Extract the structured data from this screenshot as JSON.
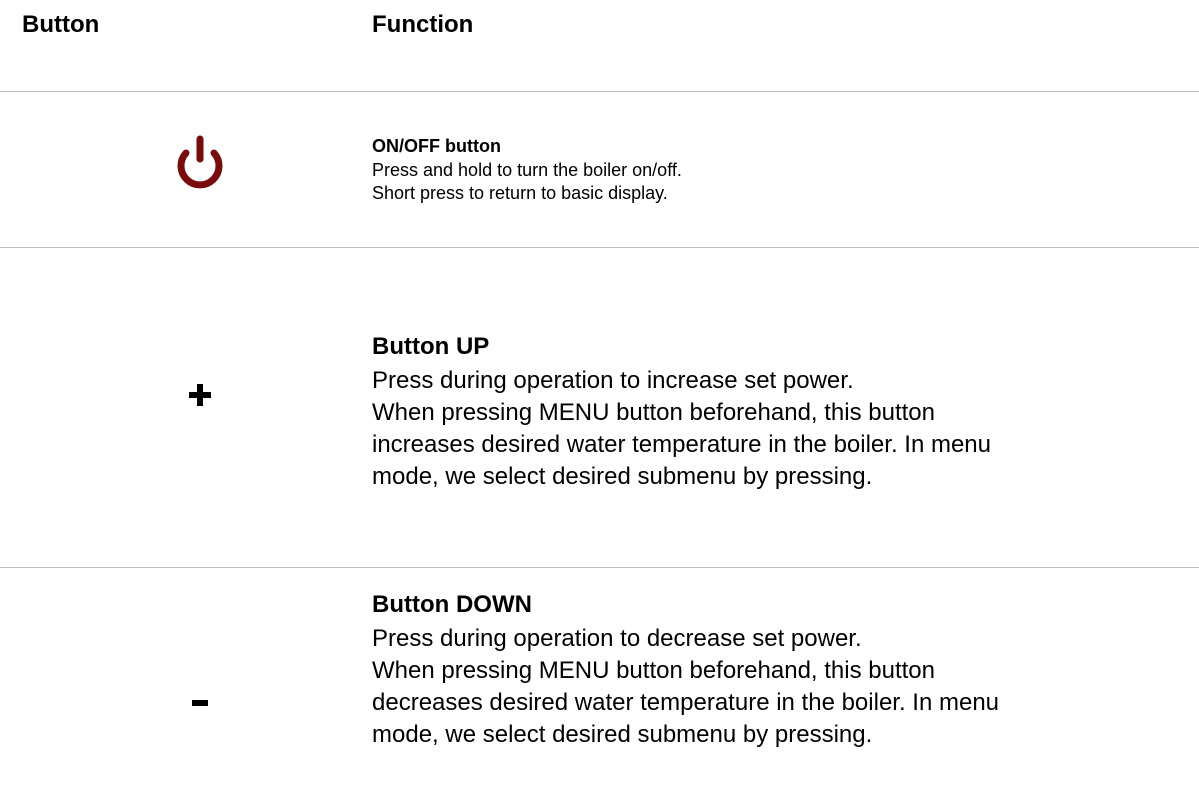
{
  "header": {
    "button_label": "Button",
    "function_label": "Function"
  },
  "rows": [
    {
      "icon": "power-icon",
      "icon_color": "#7a0c0c",
      "title": "ON/OFF button",
      "lines": [
        "Press and hold to turn the boiler on/off.",
        "Short press to return to basic display."
      ]
    },
    {
      "icon": "plus-icon",
      "icon_color": "#000000",
      "title": "Button UP",
      "lines": [
        "Press during operation to increase set power.",
        "When pressing MENU button beforehand, this button",
        "increases desired water temperature in the boiler. In menu",
        "mode, we select desired submenu by pressing."
      ]
    },
    {
      "icon": "minus-icon",
      "icon_color": "#000000",
      "title": "Button DOWN",
      "lines": [
        "Press during operation to decrease set power.",
        "When pressing MENU button beforehand, this button",
        "decreases desired water temperature in the boiler. In menu",
        "mode, we select desired submenu by pressing."
      ]
    }
  ]
}
